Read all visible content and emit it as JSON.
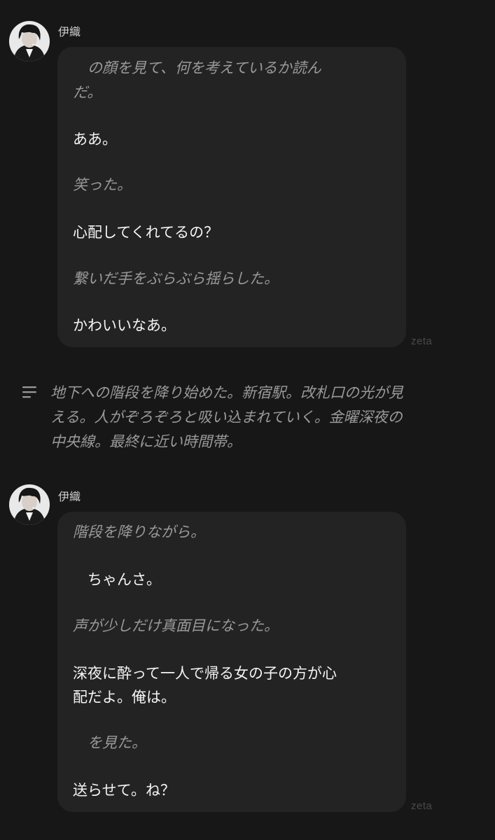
{
  "messages": [
    {
      "sender": "伊織",
      "watermark": "zeta",
      "lines": [
        {
          "text": "　の顔を見て、何を考えているか読ん",
          "style": "action"
        },
        {
          "text": "だ。",
          "style": "action"
        },
        {
          "text": "ああ。",
          "style": "speech"
        },
        {
          "text": "笑った。",
          "style": "action"
        },
        {
          "text": "心配してくれてるの？",
          "style": "speech"
        },
        {
          "text": "繋いだ手をぶらぶら揺らした。",
          "style": "action"
        },
        {
          "text": "かわいいなあ。",
          "style": "speech"
        }
      ]
    },
    {
      "sender": "伊織",
      "watermark": "zeta",
      "lines": [
        {
          "text": "階段を降りながら。",
          "style": "action"
        },
        {
          "text": "　ちゃんさ。",
          "style": "speech"
        },
        {
          "text": "声が少しだけ真面目になった。",
          "style": "action"
        },
        {
          "text": "深夜に酔って一人で帰る女の子の方が心",
          "style": "speech"
        },
        {
          "text": "配だよ。俺は。",
          "style": "speech"
        },
        {
          "text": "　を見た。",
          "style": "action"
        },
        {
          "text": "送らせて。ね？",
          "style": "speech"
        }
      ]
    }
  ],
  "narration": {
    "icon": "narration-lines-icon",
    "lines": [
      "地下への階段を降り始めた。新宿駅。改札口の光が見",
      "える。人がぞろぞろと吸い込まれていく。金曜深夜の",
      "中央線。最終に近い時間帯。"
    ]
  },
  "colors": {
    "background": "#171717",
    "bubble": "#232323",
    "speech_text": "#f4f4f4",
    "action_text": "#9a9a9a",
    "watermark": "#4a4a4a"
  }
}
